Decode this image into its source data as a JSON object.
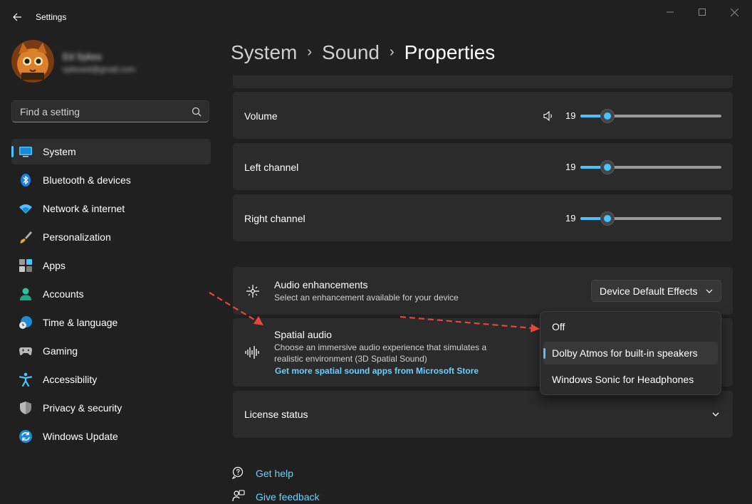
{
  "window": {
    "title": "Settings",
    "controls": [
      "minimize",
      "maximize",
      "close"
    ]
  },
  "profile": {
    "name": "Ed Sykes",
    "email": "sykesed@gmail.com"
  },
  "search": {
    "placeholder": "Find a setting"
  },
  "sidebar": {
    "items": [
      {
        "label": "System",
        "icon": "monitor-icon",
        "active": true
      },
      {
        "label": "Bluetooth & devices",
        "icon": "bluetooth-icon"
      },
      {
        "label": "Network & internet",
        "icon": "wifi-icon"
      },
      {
        "label": "Personalization",
        "icon": "brush-icon"
      },
      {
        "label": "Apps",
        "icon": "apps-icon"
      },
      {
        "label": "Accounts",
        "icon": "person-icon"
      },
      {
        "label": "Time & language",
        "icon": "globe-clock-icon"
      },
      {
        "label": "Gaming",
        "icon": "controller-icon"
      },
      {
        "label": "Accessibility",
        "icon": "accessibility-icon"
      },
      {
        "label": "Privacy & security",
        "icon": "shield-icon"
      },
      {
        "label": "Windows Update",
        "icon": "update-icon"
      }
    ]
  },
  "breadcrumb": [
    "System",
    "Sound",
    "Properties"
  ],
  "sliders": {
    "volume": {
      "label": "Volume",
      "value": "19",
      "icon": "speaker-icon"
    },
    "left": {
      "label": "Left channel",
      "value": "19"
    },
    "right": {
      "label": "Right channel",
      "value": "19"
    }
  },
  "enhancements": {
    "title": "Audio enhancements",
    "description": "Select an enhancement available for your device",
    "selected": "Device Default Effects",
    "icon": "sparkle-icon"
  },
  "spatial": {
    "title": "Spatial audio",
    "description_line1": "Choose an immersive audio experience that simulates a",
    "description_line2": "realistic environment (3D Spatial Sound)",
    "link": "Get more spatial sound apps from Microsoft Store",
    "icon": "soundwave-icon",
    "options": [
      "Off",
      "Dolby Atmos for built-in speakers",
      "Windows Sonic for Headphones"
    ],
    "selected_index": 1
  },
  "license": {
    "label": "License status"
  },
  "footer": {
    "get_help": "Get help",
    "give_feedback": "Give feedback"
  },
  "colors": {
    "accent": "#4cc2ff",
    "annotation": "#e8453c",
    "background": "#202020",
    "card": "#2b2b2b"
  }
}
